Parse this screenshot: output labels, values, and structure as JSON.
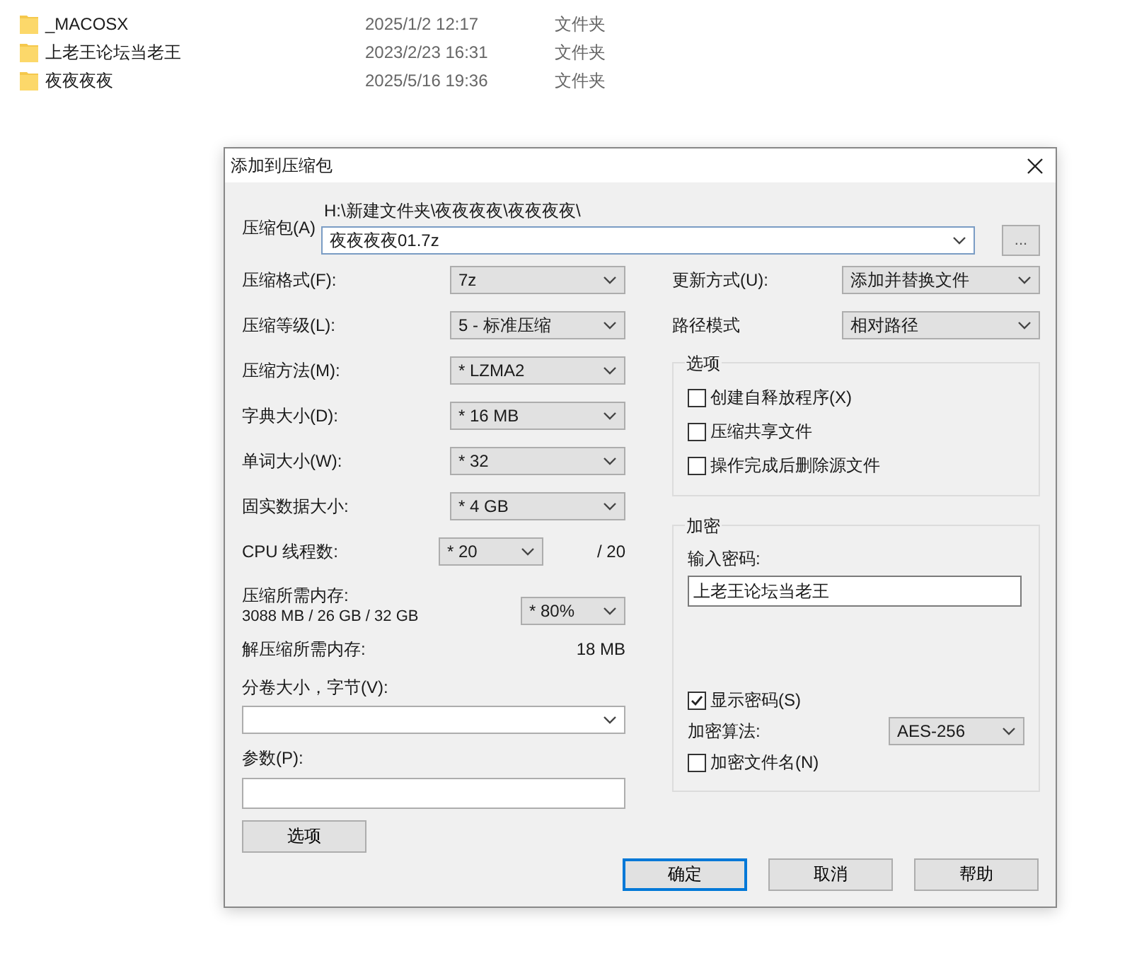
{
  "files": [
    {
      "name": "_MACOSX",
      "date": "2025/1/2 12:17",
      "type": "文件夹"
    },
    {
      "name": "上老王论坛当老王",
      "date": "2023/2/23 16:31",
      "type": "文件夹"
    },
    {
      "name": "夜夜夜夜",
      "date": "2025/5/16 19:36",
      "type": "文件夹"
    }
  ],
  "dialog": {
    "title": "添加到压缩包",
    "archive": {
      "label": "压缩包(A)",
      "path": "H:\\新建文件夹\\夜夜夜夜\\夜夜夜夜\\",
      "value": "夜夜夜夜01.7z",
      "browse": "..."
    },
    "left_fields": [
      {
        "kind": "select",
        "label": "压缩格式(F):",
        "value": "7z"
      },
      {
        "kind": "select",
        "label": "压缩等级(L):",
        "value": "5 - 标准压缩"
      },
      {
        "kind": "select",
        "label": "压缩方法(M):",
        "value": "* LZMA2"
      },
      {
        "kind": "select",
        "label": "字典大小(D):",
        "value": "* 16 MB"
      },
      {
        "kind": "select",
        "label": "单词大小(W):",
        "value": "* 32"
      },
      {
        "kind": "select",
        "label": "固实数据大小:",
        "value": "* 4 GB"
      },
      {
        "kind": "threads",
        "label": "CPU 线程数:",
        "value": "* 20",
        "suffix": "/ 20"
      },
      {
        "kind": "memory",
        "label": "压缩所需内存:",
        "detail": "3088 MB / 26 GB / 32 GB",
        "value": "* 80%"
      },
      {
        "kind": "info",
        "label": "解压缩所需内存:",
        "value": "18 MB"
      }
    ],
    "split": {
      "label": "分卷大小，字节(V):"
    },
    "params": {
      "label": "参数(P):"
    },
    "options_button": "选项",
    "right_fields": [
      {
        "label": "更新方式(U):",
        "value": "添加并替换文件"
      },
      {
        "label": "路径模式",
        "value": "相对路径"
      }
    ],
    "options_group": {
      "title": "选项",
      "items": [
        {
          "label": "创建自释放程序(X)",
          "checked": false
        },
        {
          "label": "压缩共享文件",
          "checked": false
        },
        {
          "label": "操作完成后删除源文件",
          "checked": false
        }
      ]
    },
    "encryption": {
      "title": "加密",
      "password_label": "输入密码:",
      "password": "上老王论坛当老王",
      "show_password": {
        "label": "显示密码(S)",
        "checked": true
      },
      "method_label": "加密算法:",
      "method": "AES-256",
      "encrypt_names": {
        "label": "加密文件名(N)",
        "checked": false
      }
    },
    "buttons": [
      {
        "label": "确定",
        "default": true
      },
      {
        "label": "取消",
        "default": false
      },
      {
        "label": "帮助",
        "default": false
      }
    ]
  }
}
